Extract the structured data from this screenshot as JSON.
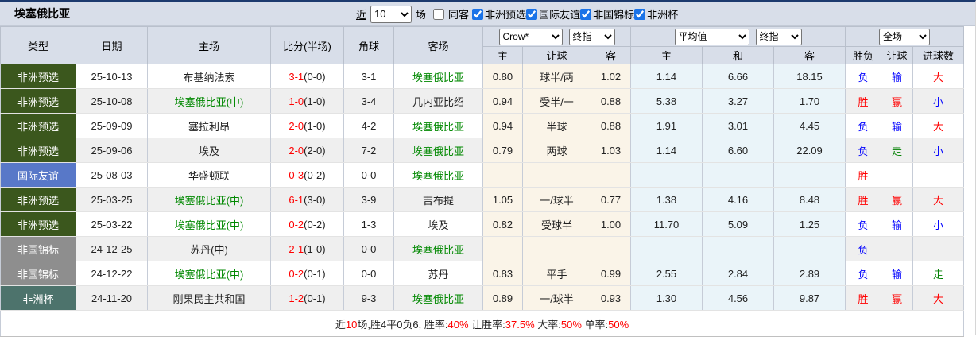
{
  "title": "埃塞俄比亚",
  "topbar": {
    "near_link": "近",
    "count_value": "10",
    "count_suffix": "场",
    "filters": [
      {
        "label": "同客",
        "checked": false
      },
      {
        "label": "非洲预选",
        "checked": true
      },
      {
        "label": "国际友谊",
        "checked": true
      },
      {
        "label": "非国锦标",
        "checked": true
      },
      {
        "label": "非洲杯",
        "checked": true
      }
    ]
  },
  "header": {
    "col_type": "类型",
    "col_date": "日期",
    "col_home": "主场",
    "col_score": "比分(半场)",
    "col_corner": "角球",
    "col_away": "客场",
    "handicap_select_1": "Crow*",
    "handicap_select_2": "终指",
    "europe_select_1": "平均值",
    "europe_select_2": "终指",
    "full_select": "全场",
    "sub_let_home": "主",
    "sub_let_line": "让球",
    "sub_let_away": "客",
    "sub_odd_home": "主",
    "sub_odd_draw": "和",
    "sub_odd_away": "客",
    "sub_result": "胜负",
    "sub_let_result": "让球",
    "sub_goals": "进球数"
  },
  "rows": [
    {
      "type": "非洲预选",
      "type_color": "#3b571d",
      "date": "25-10-13",
      "home": "布基纳法索",
      "home_color": "#222222",
      "score_ft": "3-1",
      "score_ht": "(0-0)",
      "corner": "3-1",
      "away": "埃塞俄比亚",
      "away_color": "#008800",
      "let_home": "0.80",
      "let_line": "球半/两",
      "let_away": "1.02",
      "odd_home": "1.14",
      "odd_draw": "6.66",
      "odd_away": "18.15",
      "result": "负",
      "result_color": "#0000ff",
      "let_result": "输",
      "let_result_color": "#0000ff",
      "goals": "大",
      "goals_color": "#ff0000"
    },
    {
      "type": "非洲预选",
      "type_color": "#3b571d",
      "date": "25-10-08",
      "home": "埃塞俄比亚(中)",
      "home_color": "#008800",
      "score_ft": "1-0",
      "score_ht": "(1-0)",
      "corner": "3-4",
      "away": "几内亚比绍",
      "away_color": "#222222",
      "let_home": "0.94",
      "let_line": "受半/一",
      "let_away": "0.88",
      "odd_home": "5.38",
      "odd_draw": "3.27",
      "odd_away": "1.70",
      "result": "胜",
      "result_color": "#ff0000",
      "let_result": "赢",
      "let_result_color": "#ff0000",
      "goals": "小",
      "goals_color": "#0000ff"
    },
    {
      "type": "非洲预选",
      "type_color": "#3b571d",
      "date": "25-09-09",
      "home": "塞拉利昂",
      "home_color": "#222222",
      "score_ft": "2-0",
      "score_ht": "(1-0)",
      "corner": "4-2",
      "away": "埃塞俄比亚",
      "away_color": "#008800",
      "let_home": "0.94",
      "let_line": "半球",
      "let_away": "0.88",
      "odd_home": "1.91",
      "odd_draw": "3.01",
      "odd_away": "4.45",
      "result": "负",
      "result_color": "#0000ff",
      "let_result": "输",
      "let_result_color": "#0000ff",
      "goals": "大",
      "goals_color": "#ff0000"
    },
    {
      "type": "非洲预选",
      "type_color": "#3b571d",
      "date": "25-09-06",
      "home": "埃及",
      "home_color": "#222222",
      "score_ft": "2-0",
      "score_ht": "(2-0)",
      "corner": "7-2",
      "away": "埃塞俄比亚",
      "away_color": "#008800",
      "let_home": "0.79",
      "let_line": "两球",
      "let_away": "1.03",
      "odd_home": "1.14",
      "odd_draw": "6.60",
      "odd_away": "22.09",
      "result": "负",
      "result_color": "#0000ff",
      "let_result": "走",
      "let_result_color": "#008000",
      "goals": "小",
      "goals_color": "#0000ff"
    },
    {
      "type": "国际友谊",
      "type_color": "#5878c8",
      "date": "25-08-03",
      "home": "华盛顿联",
      "home_color": "#222222",
      "score_ft": "0-3",
      "score_ht": "(0-2)",
      "corner": "0-0",
      "away": "埃塞俄比亚",
      "away_color": "#008800",
      "let_home": "",
      "let_line": "",
      "let_away": "",
      "odd_home": "",
      "odd_draw": "",
      "odd_away": "",
      "result": "胜",
      "result_color": "#ff0000",
      "let_result": "",
      "let_result_color": "#222222",
      "goals": "",
      "goals_color": "#222222"
    },
    {
      "type": "非洲预选",
      "type_color": "#3b571d",
      "date": "25-03-25",
      "home": "埃塞俄比亚(中)",
      "home_color": "#008800",
      "score_ft": "6-1",
      "score_ht": "(3-0)",
      "corner": "3-9",
      "away": "吉布提",
      "away_color": "#222222",
      "let_home": "1.05",
      "let_line": "一/球半",
      "let_away": "0.77",
      "odd_home": "1.38",
      "odd_draw": "4.16",
      "odd_away": "8.48",
      "result": "胜",
      "result_color": "#ff0000",
      "let_result": "赢",
      "let_result_color": "#ff0000",
      "goals": "大",
      "goals_color": "#ff0000"
    },
    {
      "type": "非洲预选",
      "type_color": "#3b571d",
      "date": "25-03-22",
      "home": "埃塞俄比亚(中)",
      "home_color": "#008800",
      "score_ft": "0-2",
      "score_ht": "(0-2)",
      "corner": "1-3",
      "away": "埃及",
      "away_color": "#222222",
      "let_home": "0.82",
      "let_line": "受球半",
      "let_away": "1.00",
      "odd_home": "11.70",
      "odd_draw": "5.09",
      "odd_away": "1.25",
      "result": "负",
      "result_color": "#0000ff",
      "let_result": "输",
      "let_result_color": "#0000ff",
      "goals": "小",
      "goals_color": "#0000ff"
    },
    {
      "type": "非国锦标",
      "type_color": "#8e8e8e",
      "date": "24-12-25",
      "home": "苏丹(中)",
      "home_color": "#222222",
      "score_ft": "2-1",
      "score_ht": "(1-0)",
      "corner": "0-0",
      "away": "埃塞俄比亚",
      "away_color": "#008800",
      "let_home": "",
      "let_line": "",
      "let_away": "",
      "odd_home": "",
      "odd_draw": "",
      "odd_away": "",
      "result": "负",
      "result_color": "#0000ff",
      "let_result": "",
      "let_result_color": "#222222",
      "goals": "",
      "goals_color": "#222222"
    },
    {
      "type": "非国锦标",
      "type_color": "#8e8e8e",
      "date": "24-12-22",
      "home": "埃塞俄比亚(中)",
      "home_color": "#008800",
      "score_ft": "0-2",
      "score_ht": "(0-1)",
      "corner": "0-0",
      "away": "苏丹",
      "away_color": "#222222",
      "let_home": "0.83",
      "let_line": "平手",
      "let_away": "0.99",
      "odd_home": "2.55",
      "odd_draw": "2.84",
      "odd_away": "2.89",
      "result": "负",
      "result_color": "#0000ff",
      "let_result": "输",
      "let_result_color": "#0000ff",
      "goals": "走",
      "goals_color": "#008000"
    },
    {
      "type": "非洲杯",
      "type_color": "#4d736c",
      "date": "24-11-20",
      "home": "刚果民主共和国",
      "home_color": "#222222",
      "score_ft": "1-2",
      "score_ht": "(0-1)",
      "corner": "9-3",
      "away": "埃塞俄比亚",
      "away_color": "#008800",
      "let_home": "0.89",
      "let_line": "一/球半",
      "let_away": "0.93",
      "odd_home": "1.30",
      "odd_draw": "4.56",
      "odd_away": "9.87",
      "result": "胜",
      "result_color": "#ff0000",
      "let_result": "赢",
      "let_result_color": "#ff0000",
      "goals": "大",
      "goals_color": "#ff0000"
    }
  ],
  "summary": {
    "segments": [
      {
        "text": "近",
        "color": "#222222"
      },
      {
        "text": "10",
        "color": "#ff0000"
      },
      {
        "text": "场,胜4平0负6, 胜率:",
        "color": "#222222"
      },
      {
        "text": "40%",
        "color": "#ff0000"
      },
      {
        "text": " 让胜率:",
        "color": "#222222"
      },
      {
        "text": "37.5%",
        "color": "#ff0000"
      },
      {
        "text": " 大率:",
        "color": "#222222"
      },
      {
        "text": "50%",
        "color": "#ff0000"
      },
      {
        "text": " 单率:",
        "color": "#222222"
      },
      {
        "text": "50%",
        "color": "#ff0000"
      }
    ]
  }
}
